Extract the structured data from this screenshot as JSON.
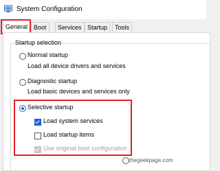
{
  "window": {
    "title": "System Configuration"
  },
  "tabs": [
    {
      "label": "General",
      "active": true
    },
    {
      "label": "Boot"
    },
    {
      "label": "Services"
    },
    {
      "label": "Startup"
    },
    {
      "label": "Tools"
    }
  ],
  "startup_selection": {
    "group_label": "Startup selection",
    "options": [
      {
        "label": "Normal startup",
        "description": "Load all device drivers and services",
        "selected": false
      },
      {
        "label": "Diagnostic startup",
        "description": "Load basic devices and services only",
        "selected": false
      },
      {
        "label": "Selective startup",
        "selected": true
      }
    ],
    "selective_items": [
      {
        "label": "Load system services",
        "checked": true,
        "disabled": false
      },
      {
        "label": "Load startup items",
        "checked": false,
        "disabled": false
      },
      {
        "label": "Use original boot configuration",
        "checked": true,
        "disabled": true
      }
    ]
  },
  "watermark": {
    "text": "thegeekpage.com"
  },
  "colors": {
    "accent": "#1a66d2",
    "highlight": "#e0202a"
  }
}
